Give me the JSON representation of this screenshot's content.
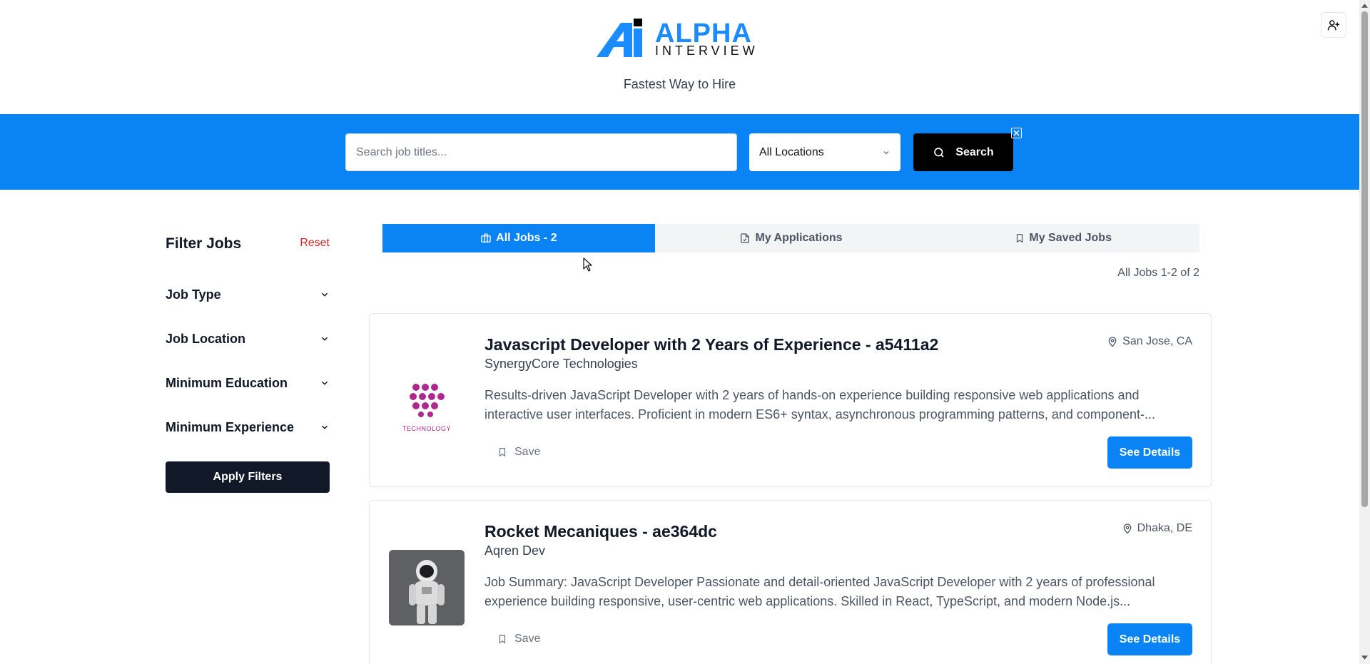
{
  "header": {
    "logo_line1": "ALPHA",
    "logo_line2": "INTERVIEW",
    "tagline": "Fastest Way to Hire",
    "user_icon": "user-plus-icon"
  },
  "search": {
    "placeholder": "Search job titles...",
    "value": "",
    "location_selected": "All Locations",
    "button_label": "Search"
  },
  "sidebar": {
    "title": "Filter Jobs",
    "reset_label": "Reset",
    "filters": [
      {
        "label": "Job Type"
      },
      {
        "label": "Job Location"
      },
      {
        "label": "Minimum Education"
      },
      {
        "label": "Minimum Experience"
      }
    ],
    "apply_label": "Apply Filters"
  },
  "tabs": [
    {
      "label": "All Jobs - 2",
      "icon": "briefcase-icon",
      "active": true
    },
    {
      "label": "My Applications",
      "icon": "document-icon",
      "active": false
    },
    {
      "label": "My Saved Jobs",
      "icon": "bookmark-icon",
      "active": false
    }
  ],
  "results_count": "All Jobs 1-2 of 2",
  "jobs": [
    {
      "title": "Javascript Developer with 2 Years of Experience - a5411a2",
      "company": "SynergyCore Technologies",
      "location": "San Jose, CA",
      "description": "Results-driven JavaScript Developer with 2 years of hands-on experience building responsive web applications and interactive user interfaces. Proficient in modern ES6+ syntax, asynchronous programming patterns, and component-...",
      "save_label": "Save",
      "details_label": "See Details",
      "logo_text": "TECHNOLOGY",
      "logo_color": "#b0278e"
    },
    {
      "title": "Rocket Mecaniques - ae364dc",
      "company": "Aqren Dev",
      "location": "Dhaka, DE",
      "description": "Job Summary: JavaScript Developer Passionate and detail-oriented JavaScript Developer with 2 years of professional experience building responsive, user-centric web applications. Skilled in React, TypeScript, and modern Node.js...",
      "save_label": "Save",
      "details_label": "See Details"
    }
  ],
  "colors": {
    "brand_blue": "#0a84f5",
    "dark": "#111827",
    "reset_red": "#dc2626"
  }
}
